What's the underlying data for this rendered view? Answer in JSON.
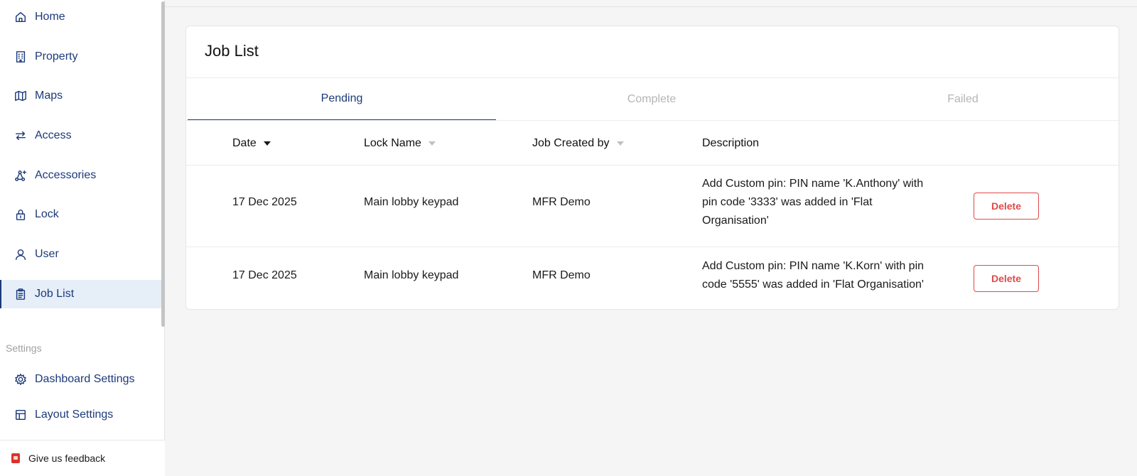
{
  "sidebar": {
    "items": [
      {
        "label": "Home",
        "icon": "home-icon"
      },
      {
        "label": "Property",
        "icon": "building-icon"
      },
      {
        "label": "Maps",
        "icon": "map-icon"
      },
      {
        "label": "Access",
        "icon": "arrows-swap-icon"
      },
      {
        "label": "Accessories",
        "icon": "network-icon"
      },
      {
        "label": "Lock",
        "icon": "lock-icon"
      },
      {
        "label": "User",
        "icon": "user-icon"
      },
      {
        "label": "Job List",
        "icon": "clipboard-icon",
        "active": true
      }
    ],
    "settings_label": "Settings",
    "settings_items": [
      {
        "label": "Dashboard Settings",
        "icon": "gear-icon"
      },
      {
        "label": "Layout Settings",
        "icon": "layout-icon"
      }
    ],
    "feedback_label": "Give us feedback"
  },
  "main": {
    "title": "Job List",
    "tabs": [
      {
        "label": "Pending",
        "active": true
      },
      {
        "label": "Complete",
        "active": false
      },
      {
        "label": "Failed",
        "active": false
      }
    ],
    "columns": [
      "Date",
      "Lock Name",
      "Job Created by",
      "Description"
    ],
    "rows": [
      {
        "date": "17 Dec 2025",
        "lock_name": "Main lobby keypad",
        "created_by": "MFR Demo",
        "description": [
          "Add Custom pin: PIN name 'K.Anthony' with",
          "pin code '3333' was added in 'Flat",
          "Organisation'"
        ],
        "action": "Delete"
      },
      {
        "date": "17 Dec 2025",
        "lock_name": "Main lobby keypad",
        "created_by": "MFR Demo",
        "description": [
          "Add Custom pin: PIN name 'K.Korn' with pin",
          "code '5555' was added in 'Flat Organisation'"
        ],
        "action": "Delete"
      }
    ]
  },
  "colors": {
    "accent": "#1c3a7a",
    "active_bg": "#e6eef8",
    "danger": "#e04a4a",
    "page_bg": "#f5f5f5"
  }
}
